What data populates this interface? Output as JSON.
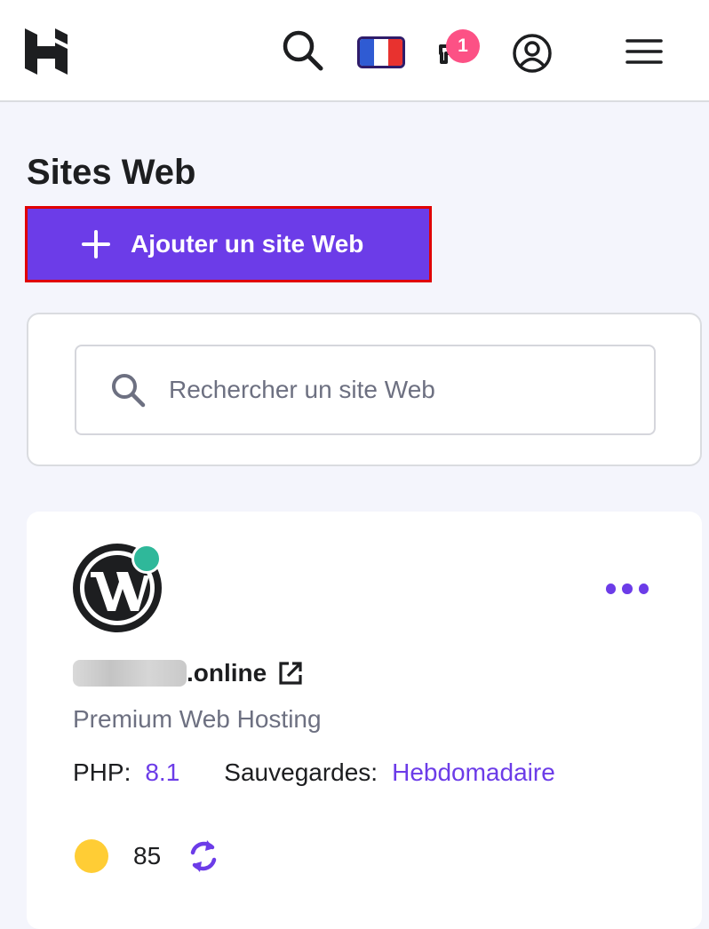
{
  "header": {
    "logo_icon": "hostinger-logo",
    "search_icon": "search-icon",
    "language_flag": "france-flag-icon",
    "notifications_icon": "megaphone-icon",
    "notifications_count": "1",
    "account_icon": "user-circle-icon",
    "menu_icon": "hamburger-menu-icon"
  },
  "page": {
    "title": "Sites Web",
    "add_button_label": "Ajouter un site Web"
  },
  "search": {
    "placeholder": "Rechercher un site Web",
    "value": ""
  },
  "website": {
    "platform_icon": "wordpress-icon",
    "status": "online",
    "domain_suffix": ".online",
    "plan": "Premium Web Hosting",
    "php_label": "PHP:",
    "php_version": "8.1",
    "backups_label": "Sauvegardes:",
    "backups_value": "Hebdomadaire",
    "score": "85"
  },
  "colors": {
    "accent": "#6c3ce8",
    "badge": "#fc5185",
    "status_online": "#2fb89a",
    "score_medium": "#ffcd35",
    "highlight_border": "#e00000"
  }
}
